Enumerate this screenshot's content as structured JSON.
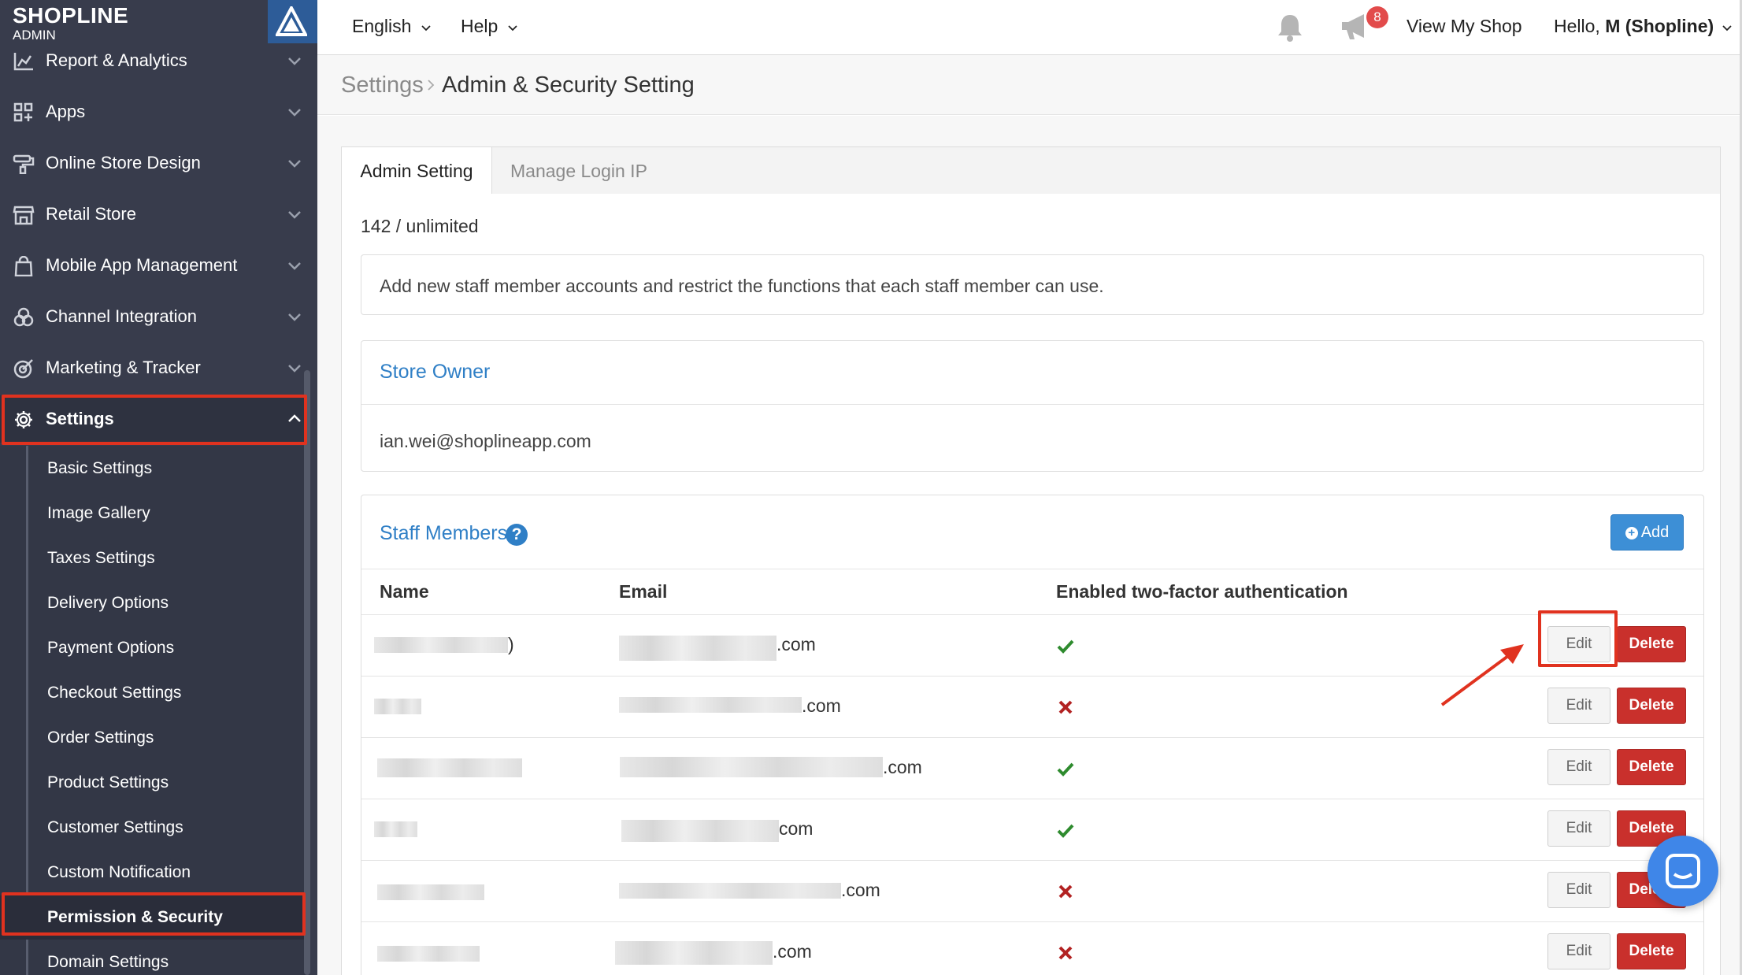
{
  "brand": {
    "name": "SHOPLINE",
    "subtitle": "ADMIN"
  },
  "sidebar": {
    "items": [
      {
        "label": "Report & Analytics",
        "icon": "chart-icon"
      },
      {
        "label": "Apps",
        "icon": "apps-grid-icon"
      },
      {
        "label": "Online Store Design",
        "icon": "paint-roller-icon"
      },
      {
        "label": "Retail Store",
        "icon": "store-icon"
      },
      {
        "label": "Mobile App Management",
        "icon": "shopping-bag-icon"
      },
      {
        "label": "Channel Integration",
        "icon": "channels-icon"
      },
      {
        "label": "Marketing & Tracker",
        "icon": "target-icon"
      },
      {
        "label": "Settings",
        "icon": "gear-icon"
      }
    ],
    "settings_sub": [
      "Basic Settings",
      "Image Gallery",
      "Taxes Settings",
      "Delivery Options",
      "Payment Options",
      "Checkout Settings",
      "Order Settings",
      "Product Settings",
      "Customer Settings",
      "Custom Notification",
      "Permission & Security",
      "Domain Settings"
    ]
  },
  "header": {
    "language": "English",
    "help": "Help",
    "notification_count": "8",
    "view_shop": "View My Shop",
    "greeting": "Hello,",
    "user": "M (Shopline)"
  },
  "breadcrumb": {
    "root": "Settings",
    "current": "Admin & Security Setting"
  },
  "tabs": {
    "admin": "Admin Setting",
    "ip": "Manage Login IP"
  },
  "quota": "142 / unlimited",
  "description": "Add new staff member accounts and restrict the functions that each staff member can use.",
  "owner": {
    "title": "Store Owner",
    "email": "ian.wei@shoplineapp.com"
  },
  "staff": {
    "title": "Staff Members",
    "help": "?",
    "add_label": "Add",
    "columns": {
      "name": "Name",
      "email": "Email",
      "tfa": "Enabled two-factor authentication"
    },
    "rows": [
      {
        "name_suffix": ")",
        "email_suffix": ".com",
        "tfa": true
      },
      {
        "name_suffix": "",
        "email_suffix": ".com",
        "tfa": false
      },
      {
        "name_suffix": "",
        "email_suffix": ".com",
        "tfa": true
      },
      {
        "name_suffix": "",
        "email_suffix": "com",
        "tfa": true
      },
      {
        "name_suffix": "",
        "email_suffix": ".com",
        "tfa": false
      },
      {
        "name_suffix": "",
        "email_suffix": ".com",
        "tfa": false
      }
    ],
    "edit_label": "Edit",
    "delete_label": "Delete"
  },
  "colors": {
    "sidebar": "#383c4c",
    "accent": "#2f7fc6",
    "danger": "#c9302c",
    "highlight": "#e0321f",
    "success": "#2e8b2e",
    "error": "#b22222"
  }
}
